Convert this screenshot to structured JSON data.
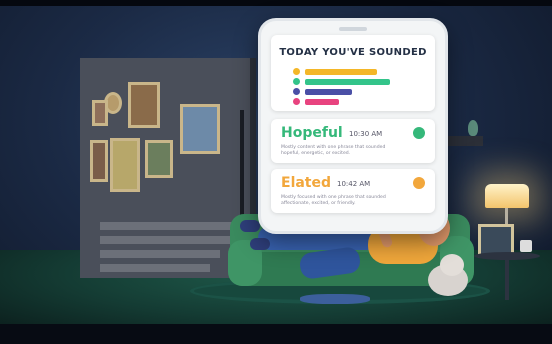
{
  "app_card": {
    "title": "TODAY YOU'VE SOUNDED",
    "bars": [
      {
        "color": "#f4b728",
        "fraction": 0.65
      },
      {
        "color": "#33c48a",
        "fraction": 0.77
      },
      {
        "color": "#4a4fa6",
        "fraction": 0.43
      },
      {
        "color": "#e8437f",
        "fraction": 0.31
      }
    ]
  },
  "moods": [
    {
      "name": "Hopeful",
      "time": "10:30 AM",
      "description": "Mostly content with one phrase that sounded hopeful, energetic, or excited.",
      "color": "#35b87a",
      "icon": "smile-face-icon"
    },
    {
      "name": "Elated",
      "time": "10:42 AM",
      "description": "Mostly focused with one phrase that sounded affectionate, excited, or friendly.",
      "color": "#f2a73c",
      "icon": "grin-face-icon"
    }
  ]
}
